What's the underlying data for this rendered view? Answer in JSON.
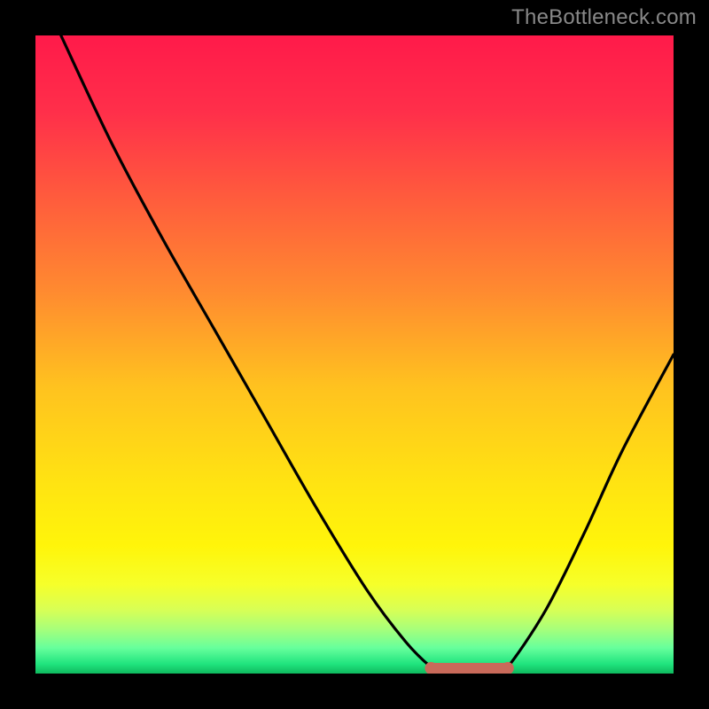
{
  "watermark": {
    "text": "TheBottleneck.com"
  },
  "plot": {
    "gradient_stops": [
      {
        "offset": 0.0,
        "color": "#ff1a4a"
      },
      {
        "offset": 0.12,
        "color": "#ff2f4a"
      },
      {
        "offset": 0.25,
        "color": "#ff5a3d"
      },
      {
        "offset": 0.4,
        "color": "#ff8a30"
      },
      {
        "offset": 0.55,
        "color": "#ffc21f"
      },
      {
        "offset": 0.7,
        "color": "#ffe312"
      },
      {
        "offset": 0.8,
        "color": "#fff50a"
      },
      {
        "offset": 0.86,
        "color": "#f6ff2a"
      },
      {
        "offset": 0.9,
        "color": "#d8ff55"
      },
      {
        "offset": 0.93,
        "color": "#a8ff7a"
      },
      {
        "offset": 0.96,
        "color": "#66ff9c"
      },
      {
        "offset": 0.985,
        "color": "#20e47e"
      },
      {
        "offset": 1.0,
        "color": "#0fb95e"
      }
    ],
    "flat_segment": {
      "enabled": true,
      "color": "#c96a5a",
      "thickness": 12,
      "dot_radius": 7
    }
  },
  "chart_data": {
    "type": "line",
    "title": "",
    "xlabel": "",
    "ylabel": "",
    "xlim": [
      0,
      100
    ],
    "ylim": [
      0,
      100
    ],
    "series": [
      {
        "name": "bottleneck-curve",
        "points": [
          {
            "x": 4,
            "y": 100
          },
          {
            "x": 12,
            "y": 83
          },
          {
            "x": 20,
            "y": 68
          },
          {
            "x": 28,
            "y": 54
          },
          {
            "x": 36,
            "y": 40
          },
          {
            "x": 44,
            "y": 26
          },
          {
            "x": 52,
            "y": 13
          },
          {
            "x": 58,
            "y": 5
          },
          {
            "x": 62,
            "y": 1
          },
          {
            "x": 64,
            "y": 0
          },
          {
            "x": 72,
            "y": 0
          },
          {
            "x": 74,
            "y": 1
          },
          {
            "x": 80,
            "y": 10
          },
          {
            "x": 86,
            "y": 22
          },
          {
            "x": 92,
            "y": 35
          },
          {
            "x": 100,
            "y": 50
          }
        ]
      }
    ],
    "flat_region": {
      "x_start": 62,
      "x_end": 74,
      "y": 0
    },
    "annotations": []
  }
}
